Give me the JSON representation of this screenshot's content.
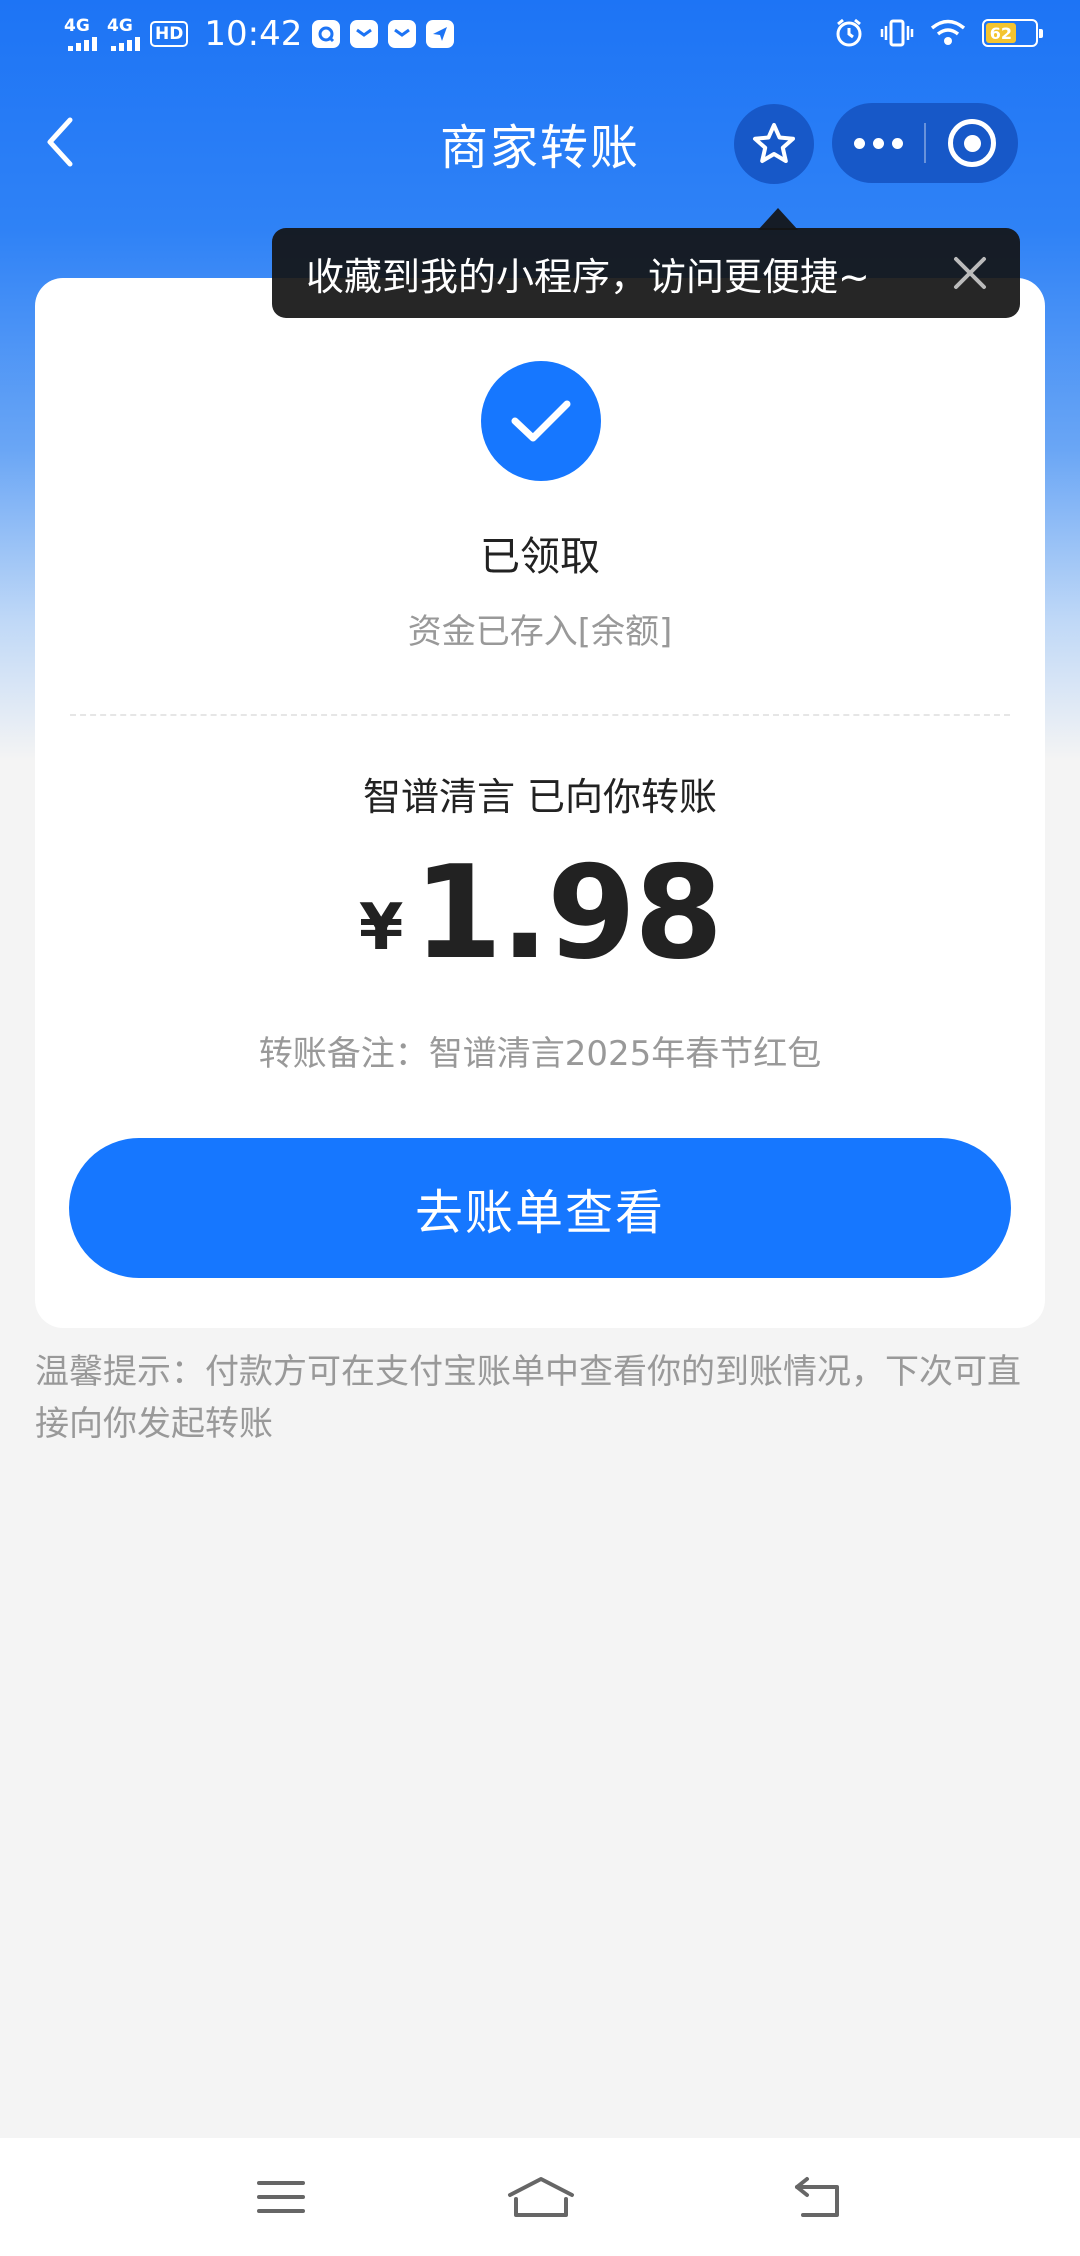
{
  "status_bar": {
    "time": "10:42",
    "signal_label_1": "4G",
    "signal_label_2": "4G",
    "hd_label": "HD",
    "battery": "62"
  },
  "nav": {
    "title": "商家转账"
  },
  "tooltip": {
    "text": "收藏到我的小程序，访问更便捷~"
  },
  "card": {
    "status_title": "已领取",
    "status_sub": "资金已存入[余额]",
    "sender_line": "智谱清言 已向你转账",
    "currency": "¥",
    "amount": "1.98",
    "remark": "转账备注：智谱清言2025年春节红包",
    "button_label": "去账单查看"
  },
  "tip": "温馨提示：付款方可在支付宝账单中查看你的到账情况，下次可直接向你发起转账",
  "colors": {
    "brand": "#1677ff",
    "header": "#1d74f5",
    "muted_text": "#999999"
  },
  "icons": [
    "back-arrow-icon",
    "star-icon",
    "more-dots-icon",
    "close-target-icon",
    "check-icon",
    "close-icon",
    "menu-icon",
    "home-icon",
    "back-icon"
  ]
}
